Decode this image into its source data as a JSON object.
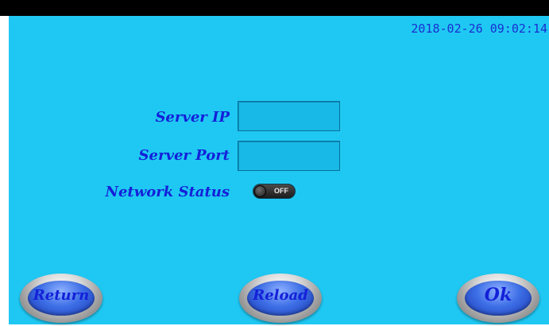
{
  "header": {
    "datetime": "2018-02-26 09:02:14"
  },
  "form": {
    "server_ip_label": "Server IP",
    "server_ip_value": "",
    "server_port_label": "Server Port",
    "server_port_value": "",
    "network_status_label": "Network Status",
    "network_status_state": "OFF"
  },
  "buttons": {
    "return_label": "Return",
    "reload_label": "Reload",
    "ok_label": "Ok"
  },
  "colors": {
    "background": "#1fc8f3",
    "label_text": "#1420d8",
    "top_bar": "#000000"
  }
}
